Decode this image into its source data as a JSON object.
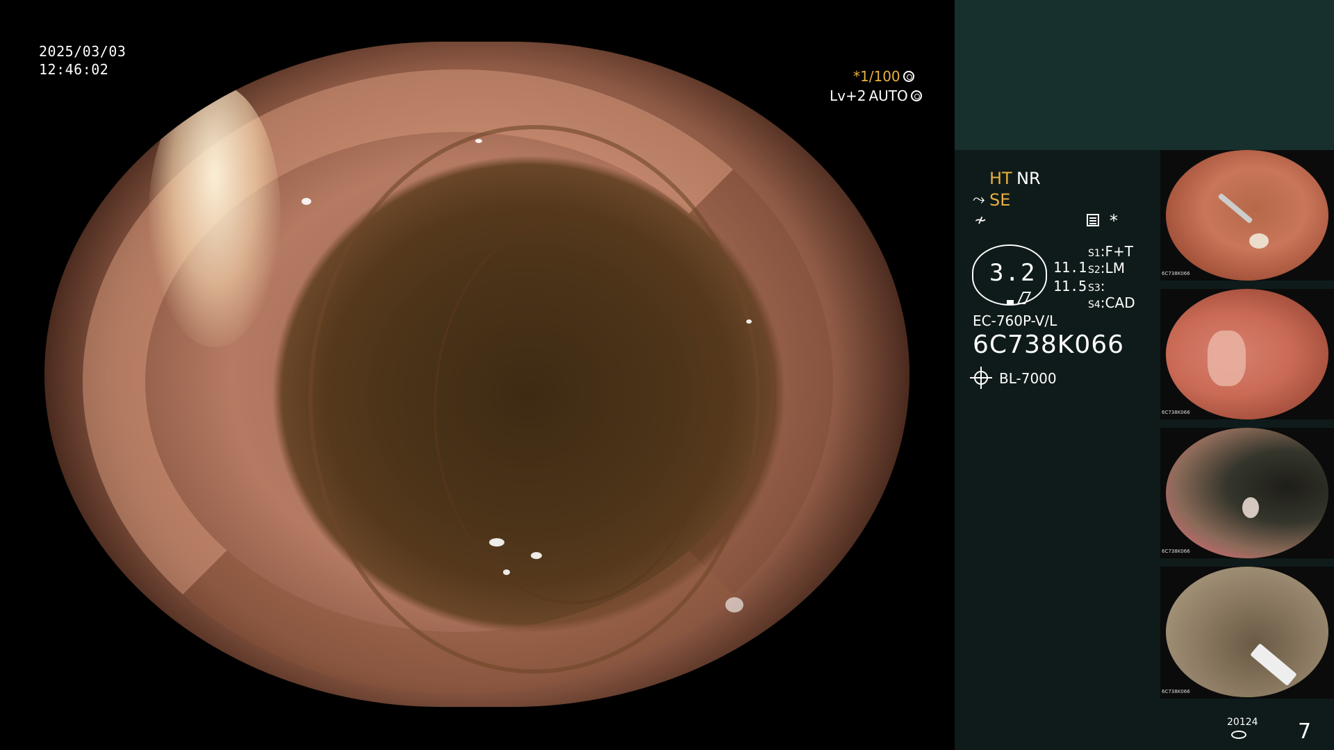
{
  "overlay": {
    "date": "2025/03/03",
    "time": "12:46:02",
    "shutter": "*1/100",
    "level": "Lv+2",
    "iris": "AUTO"
  },
  "settings": {
    "mode_ht": "HT",
    "mode_nr": "NR",
    "mode_se": "SE",
    "star": "*",
    "zoom": "3.2",
    "value_a": "11.1",
    "value_b": "11.5",
    "switches": [
      {
        "key": "S1",
        "value": "F+T"
      },
      {
        "key": "S2",
        "value": "LM"
      },
      {
        "key": "S3",
        "value": ""
      },
      {
        "key": "S4",
        "value": "CAD"
      }
    ],
    "scope_model": "EC-760P-V/L",
    "scope_serial": "6C738K066",
    "light_source": "BL-7000"
  },
  "thumbnails": [
    {
      "caption": "6C738K066"
    },
    {
      "caption": "6C738K066"
    },
    {
      "caption": "6C738K066"
    },
    {
      "caption": "6C738K066"
    }
  ],
  "footer": {
    "counter_id": "20124",
    "image_count": "7"
  },
  "colors": {
    "accent": "#e8b040",
    "panel_bg": "#0f1b1a",
    "panel_top": "#17302d"
  }
}
